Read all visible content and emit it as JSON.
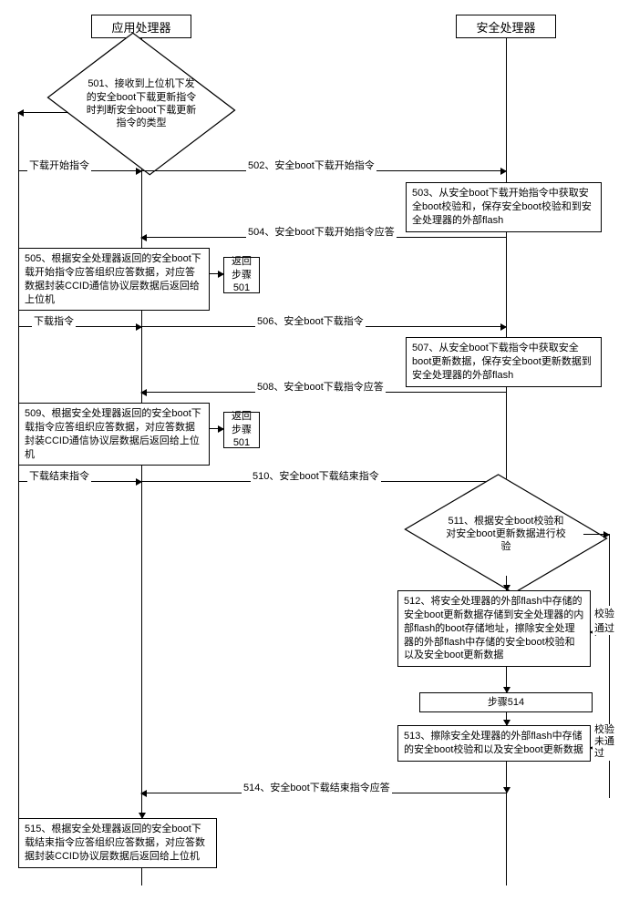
{
  "headers": {
    "app": "应用处理器",
    "sec": "安全处理器"
  },
  "diamond1": "501、接收到上位机下发的安全boot下载更新指令时判断安全boot下载更新指令的类型",
  "branch": {
    "start": "下载开始指令",
    "dl": "下载指令",
    "end": "下载结束指令"
  },
  "msg502": "502、安全boot下载开始指令",
  "box503": "503、从安全boot下载开始指令中获取安全boot校验和，保存安全boot校验和到安全处理器的外部flash",
  "msg504": "504、安全boot下载开始指令应答",
  "box505": "505、根据安全处理器返回的安全boot下载开始指令应答组织应答数据，对应答数据封装CCID通信协议层数据后返回给上位机",
  "ret505": "返回步骤501",
  "msg506": "506、安全boot下载指令",
  "box507": "507、从安全boot下载指令中获取安全boot更新数据，保存安全boot更新数据到安全处理器的外部flash",
  "msg508": "508、安全boot下载指令应答",
  "box509": "509、根据安全处理器返回的安全boot下载指令应答组织应答数据，对应答数据封装CCID通信协议层数据后返回给上位机",
  "ret509": "返回步骤501",
  "msg510": "510、安全boot下载结束指令",
  "diamond511": "511、根据安全boot校验和对安全boot更新数据进行校验",
  "check": {
    "pass": "校验通过",
    "fail": "校验未通过"
  },
  "box512": "512、将安全处理器的外部flash中存储的安全boot更新数据存储到安全处理器的内部flash的boot存储地址，擦除安全处理器的外部flash中存储的安全boot校验和以及安全boot更新数据",
  "step514": "步骤514",
  "box513": "513、擦除安全处理器的外部flash中存储的安全boot校验和以及安全boot更新数据",
  "msg514": "514、安全boot下载结束指令应答",
  "box515": "515、根据安全处理器返回的安全boot下载结束指令应答组织应答数据，对应答数据封装CCID协议层数据后返回给上位机"
}
